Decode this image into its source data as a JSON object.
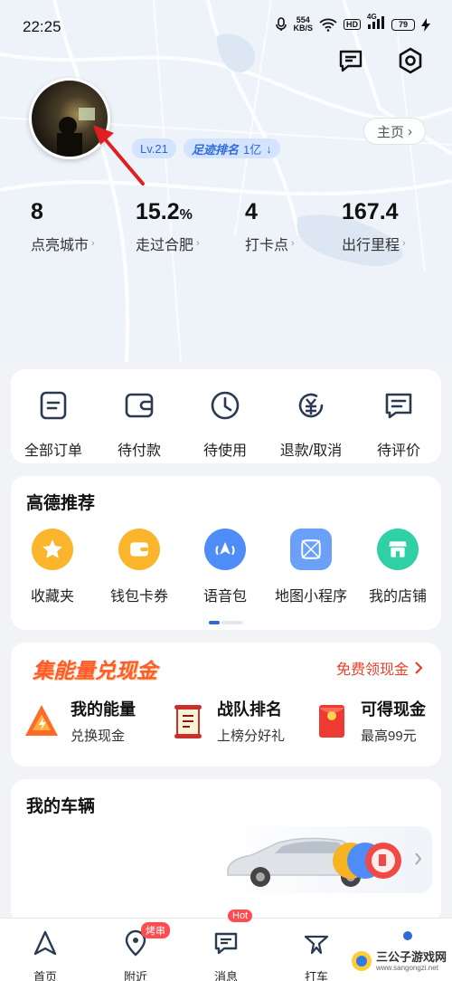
{
  "status_bar": {
    "time": "22:25",
    "net_speed": "554",
    "net_unit": "KB/S",
    "hd": "HD",
    "signal": "4G",
    "battery": "79"
  },
  "profile": {
    "level": "Lv.21",
    "rank_label": "足迹排名",
    "rank_value": "1亿",
    "homepage_label": "主页"
  },
  "stats": [
    {
      "value": "8",
      "unit": "",
      "label": "点亮城市"
    },
    {
      "value": "15.2",
      "unit": "%",
      "label": "走过合肥"
    },
    {
      "value": "4",
      "unit": "",
      "label": "打卡点"
    },
    {
      "value": "167.4",
      "unit": "",
      "label": "出行里程"
    }
  ],
  "orders": [
    {
      "label": "全部订单",
      "icon": "order-list-icon"
    },
    {
      "label": "待付款",
      "icon": "wallet-icon"
    },
    {
      "label": "待使用",
      "icon": "clock-icon"
    },
    {
      "label": "退款/取消",
      "icon": "refund-icon"
    },
    {
      "label": "待评价",
      "icon": "comment-icon"
    }
  ],
  "recommend": {
    "title": "高德推荐",
    "items": [
      {
        "label": "收藏夹",
        "icon": "star-icon",
        "color": "#fbb52d"
      },
      {
        "label": "钱包卡券",
        "icon": "wallet-card-icon",
        "color": "#fbb52d"
      },
      {
        "label": "语音包",
        "icon": "voice-navigation-icon",
        "color": "#4e8cf7"
      },
      {
        "label": "地图小程序",
        "icon": "mini-program-icon",
        "color": "#6aa0f8"
      },
      {
        "label": "我的店铺",
        "icon": "store-icon",
        "color": "#2fd0a5"
      }
    ]
  },
  "energy": {
    "title": "集能量兑现金",
    "link": "免费领现金",
    "items": [
      {
        "title": "我的能量",
        "sub": "兑换现金",
        "icon": "energy-icon"
      },
      {
        "title": "战队排名",
        "sub": "上榜分好礼",
        "icon": "ranking-scroll-icon"
      },
      {
        "title": "可得现金",
        "sub": "最高99元",
        "icon": "red-envelope-icon"
      }
    ]
  },
  "vehicle": {
    "title": "我的车辆"
  },
  "tabbar": [
    {
      "label": "首页",
      "icon": "navigation-arrow-icon"
    },
    {
      "label": "附近",
      "icon": "location-pin-icon",
      "badge": "烤串"
    },
    {
      "label": "消息",
      "icon": "message-icon",
      "badge": "Hot"
    },
    {
      "label": "打车",
      "icon": "taxi-icon"
    }
  ],
  "watermark": {
    "title": "三公子游戏网",
    "url": "www.sangongzi.net"
  },
  "colors": {
    "accent_blue": "#2c6bd6",
    "energy_red": "#e7402c",
    "annotation_arrow": "#e02020"
  }
}
